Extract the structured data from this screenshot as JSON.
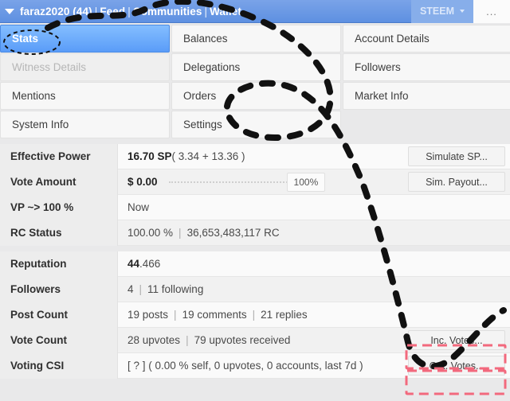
{
  "header": {
    "caret_icon": "caret-down-icon",
    "account": "faraz2020 (44)",
    "nav": [
      "Feed",
      "Communities",
      "Wallet"
    ],
    "separator": "|",
    "currency": "STEEM",
    "currency_caret_icon": "caret-down-small-icon",
    "overflow_label": "..."
  },
  "tabs": [
    {
      "label": "Stats",
      "state": "active"
    },
    {
      "label": "Balances",
      "state": "normal"
    },
    {
      "label": "Account Details",
      "state": "normal"
    },
    {
      "label": "Witness Details",
      "state": "disabled"
    },
    {
      "label": "Delegations",
      "state": "normal"
    },
    {
      "label": "Followers",
      "state": "normal"
    },
    {
      "label": "Mentions",
      "state": "normal"
    },
    {
      "label": "Orders",
      "state": "normal"
    },
    {
      "label": "Market Info",
      "state": "normal"
    },
    {
      "label": "System Info",
      "state": "normal"
    },
    {
      "label": "Settings",
      "state": "normal"
    },
    {
      "label": "",
      "state": "empty"
    }
  ],
  "stats": {
    "group_one": [
      {
        "label": "Effective Power",
        "value_strong": "16.70 SP",
        "value_rest": " ( 3.34 + 13.36 )",
        "button": "Simulate SP..."
      },
      {
        "label": "Vote Amount",
        "value_strong": "$ 0.00",
        "value_rest": "",
        "slider_value": "100%",
        "button": "Sim. Payout..."
      },
      {
        "label": "VP ~> 100 %",
        "value_strong": "",
        "value_rest": "Now"
      },
      {
        "label": "RC Status",
        "value_strong": "",
        "value_rest": "100.00 %",
        "value_pipe": "|",
        "value_tail": "36,653,483,117 RC"
      }
    ],
    "group_two": [
      {
        "label": "Reputation",
        "value_strong": "44",
        "value_rest": ".466"
      },
      {
        "label": "Followers",
        "value_strong": "4",
        "value_pipe": "|",
        "value_tail": "11 following"
      },
      {
        "label": "Post Count",
        "value_strong": "19 posts",
        "value_pipe": "|",
        "value_mid": "19 comments",
        "value_pipe2": "|",
        "value_tail": "21 replies"
      },
      {
        "label": "Vote Count",
        "value_strong": "28 upvotes",
        "value_pipe": "|",
        "value_tail": "79 upvotes received",
        "button": "Inc. Votes..."
      },
      {
        "label": "Voting CSI",
        "value_strong": "",
        "value_rest": "[ ? ] ( 0.00 % self, 0 upvotes, 0 accounts, last 7d )",
        "button": "Out. Votes..."
      }
    ]
  },
  "annotations": {
    "ellipse_stats_label": "dashed-ellipse-around-stats-tab",
    "curve_main": "dashed-black-curve",
    "loop_center": "dashed-black-loop",
    "highlight_inc_votes": "red-dashed-rectangle",
    "highlight_out_votes": "red-dashed-rectangle",
    "stroke_color": "#111111",
    "highlight_color": "#f2697d"
  }
}
